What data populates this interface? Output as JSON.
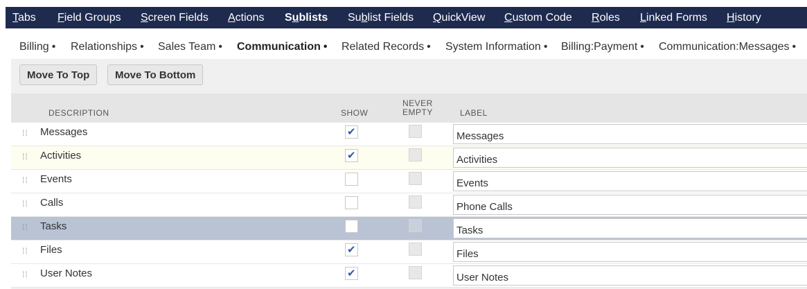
{
  "top_nav": [
    {
      "pre": "",
      "acc": "T",
      "post": "abs",
      "active": false
    },
    {
      "pre": "",
      "acc": "F",
      "post": "ield Groups",
      "active": false
    },
    {
      "pre": "",
      "acc": "S",
      "post": "creen Fields",
      "active": false
    },
    {
      "pre": "",
      "acc": "A",
      "post": "ctions",
      "active": false
    },
    {
      "pre": "S",
      "acc": "u",
      "post": "blists",
      "active": true
    },
    {
      "pre": "Su",
      "acc": "b",
      "post": "list Fields",
      "active": false
    },
    {
      "pre": "",
      "acc": "Q",
      "post": "uickView",
      "active": false
    },
    {
      "pre": "",
      "acc": "C",
      "post": "ustom Code",
      "active": false
    },
    {
      "pre": "",
      "acc": "R",
      "post": "oles",
      "active": false
    },
    {
      "pre": "",
      "acc": "L",
      "post": "inked Forms",
      "active": false
    },
    {
      "pre": "",
      "acc": "H",
      "post": "istory",
      "active": false
    }
  ],
  "sub_tabs": [
    {
      "label": "Billing",
      "active": false
    },
    {
      "label": "Relationships",
      "active": false
    },
    {
      "label": "Sales Team",
      "active": false
    },
    {
      "label": "Communication",
      "active": true
    },
    {
      "label": "Related Records",
      "active": false
    },
    {
      "label": "System Information",
      "active": false
    },
    {
      "label": "Billing:Payment",
      "active": false
    },
    {
      "label": "Communication:Messages",
      "active": false
    }
  ],
  "bullet": "•",
  "buttons": {
    "move_top": "Move To Top",
    "move_bottom": "Move To Bottom"
  },
  "headers": {
    "description": "DESCRIPTION",
    "show": "SHOW",
    "never_empty_1": "NEVER",
    "never_empty_2": "EMPTY",
    "label": "LABEL"
  },
  "rows": [
    {
      "description": "Messages",
      "show": true,
      "label": "Messages",
      "state": "normal"
    },
    {
      "description": "Activities",
      "show": true,
      "label": "Activities",
      "state": "hover"
    },
    {
      "description": "Events",
      "show": false,
      "label": "Events",
      "state": "normal"
    },
    {
      "description": "Calls",
      "show": false,
      "label": "Phone Calls",
      "state": "normal"
    },
    {
      "description": "Tasks",
      "show": false,
      "label": "Tasks",
      "state": "selected"
    },
    {
      "description": "Files",
      "show": true,
      "label": "Files",
      "state": "normal"
    },
    {
      "description": "User Notes",
      "show": true,
      "label": "User Notes",
      "state": "normal"
    }
  ],
  "colors": {
    "nav_bg": "#1e2b4f",
    "check": "#2d5aa6",
    "selected_row": "#b9c3d3",
    "hover_row": "#fdfdf0"
  }
}
